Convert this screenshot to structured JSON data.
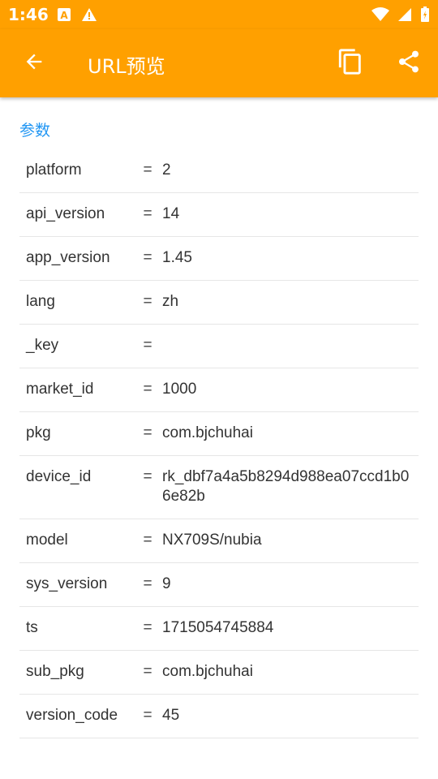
{
  "status_bar": {
    "time": "1:46",
    "icons": [
      "a-icon",
      "alert-triangle-icon",
      "wifi-icon",
      "signal-icon",
      "battery-icon"
    ]
  },
  "app_bar": {
    "title": "URL预览",
    "back_icon": "arrow-back-icon",
    "copy_icon": "copy-icon",
    "share_icon": "share-icon",
    "background": "#FFA000"
  },
  "section": {
    "title": "参数",
    "color": "#2196F3"
  },
  "params": [
    {
      "key": "platform",
      "eq": "=",
      "value": "2"
    },
    {
      "key": "api_version",
      "eq": "=",
      "value": "14"
    },
    {
      "key": "app_version",
      "eq": "=",
      "value": "1.45"
    },
    {
      "key": "lang",
      "eq": "=",
      "value": "zh"
    },
    {
      "key": "_key",
      "eq": "=",
      "value": ""
    },
    {
      "key": "market_id",
      "eq": "=",
      "value": "1000"
    },
    {
      "key": "pkg",
      "eq": "=",
      "value": "com.bjchuhai"
    },
    {
      "key": "device_id",
      "eq": "=",
      "value": "rk_dbf7a4a5b8294d988ea07ccd1b06e82b"
    },
    {
      "key": "model",
      "eq": "=",
      "value": "NX709S/nubia"
    },
    {
      "key": "sys_version",
      "eq": "=",
      "value": "9"
    },
    {
      "key": "ts",
      "eq": "=",
      "value": "1715054745884"
    },
    {
      "key": "sub_pkg",
      "eq": "=",
      "value": "com.bjchuhai"
    },
    {
      "key": "version_code",
      "eq": "=",
      "value": "45"
    }
  ]
}
